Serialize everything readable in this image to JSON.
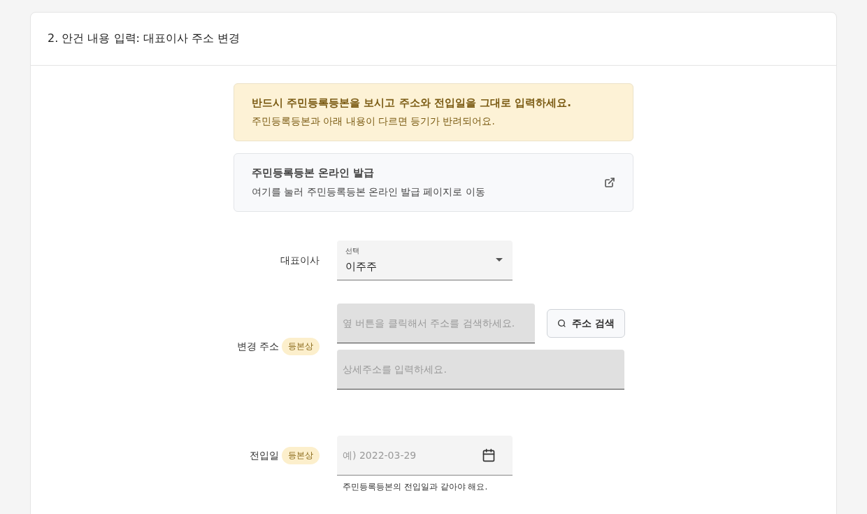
{
  "card": {
    "title": "2. 안건 내용 입력: 대표이사 주소 변경"
  },
  "notice": {
    "title": "반드시 주민등록등본을 보시고 주소와 전입일을 그대로 입력하세요.",
    "text": "주민등록등본과 아래 내용이 다르면 등기가 반려되어요."
  },
  "link_card": {
    "title": "주민등록등본 온라인 발급",
    "text": "여기를 눌러 주민등록등본 온라인 발급 페이지로 이동"
  },
  "representative": {
    "label": "대표이사",
    "select_label": "선택",
    "value": "이주주"
  },
  "address": {
    "label": "변경 주소",
    "badge": "등본상",
    "search_field": {
      "placeholder": "옆 버튼을 클릭해서 주소를 검색하세요.",
      "disabled": true
    },
    "search_button": "주소 검색",
    "detail_field": {
      "placeholder": "상세주소를 입력하세요.",
      "disabled": true
    }
  },
  "move_in_date": {
    "label": "전입일",
    "badge": "등본상",
    "placeholder": "예) 2022-03-29",
    "helper": "주민등록등본의 전입일과 같아야 해요."
  }
}
